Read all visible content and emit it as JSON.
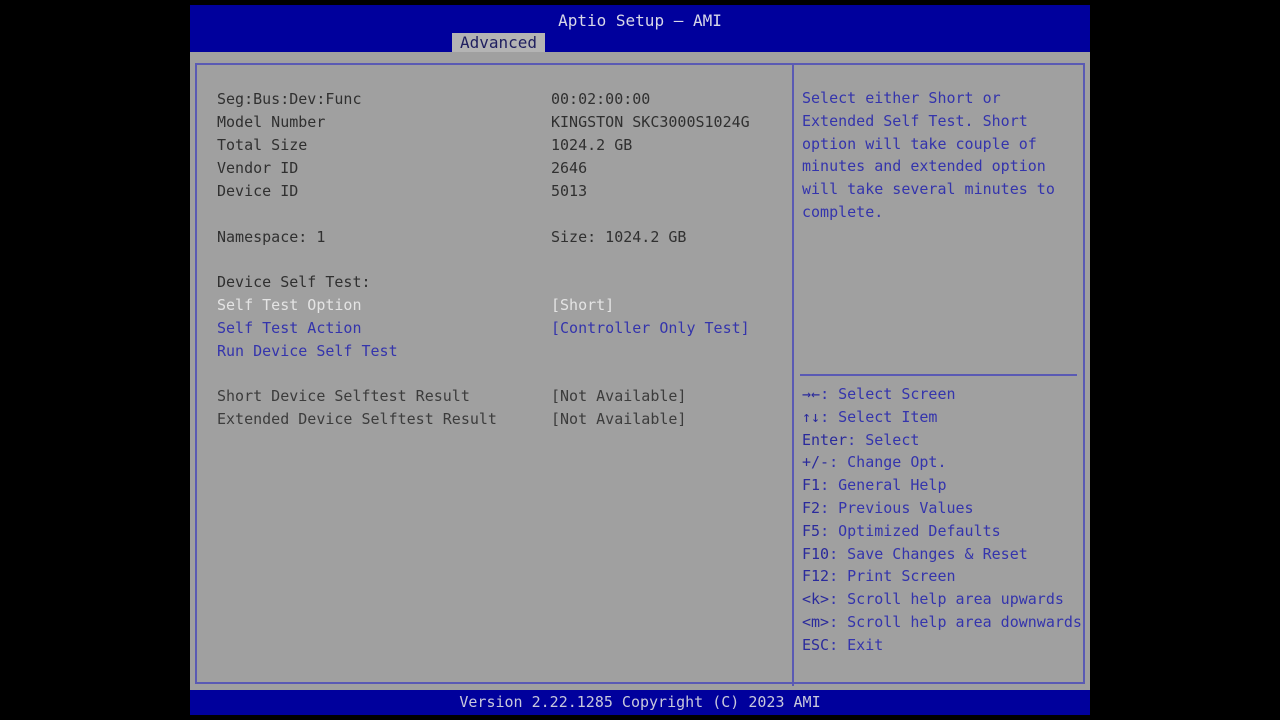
{
  "header": {
    "title": "Aptio Setup – AMI",
    "tabs": [
      {
        "label": "Advanced",
        "active": true
      }
    ]
  },
  "left_pane": {
    "info_rows": [
      {
        "label": "Seg:Bus:Dev:Func",
        "value": "00:02:00:00"
      },
      {
        "label": "Model Number",
        "value": "KINGSTON SKC3000S1024G"
      },
      {
        "label": "Total Size",
        "value": "1024.2 GB"
      },
      {
        "label": "Vendor ID",
        "value": "2646"
      },
      {
        "label": "Device ID",
        "value": "5013"
      }
    ],
    "namespace_row": {
      "label": "Namespace: 1",
      "value": "Size: 1024.2 GB"
    },
    "section_header": "Device Self Test:",
    "self_test_rows": [
      {
        "label": "Self Test Option",
        "value": "[Short]",
        "state": "selected"
      },
      {
        "label": "Self Test Action",
        "value": "[Controller Only Test]",
        "state": "link"
      },
      {
        "label": "Run Device Self Test",
        "value": "",
        "state": "link"
      }
    ],
    "result_rows": [
      {
        "label": "Short Device Selftest Result",
        "value": "[Not Available]"
      },
      {
        "label": "Extended Device Selftest Result",
        "value": "[Not Available]"
      }
    ]
  },
  "right_pane": {
    "help_text": "Select either Short or Extended Self Test. Short option will take couple of minutes and extended option will take several minutes to complete.",
    "legend": [
      {
        "key": "→←",
        "label": ": Select Screen"
      },
      {
        "key": "↑↓",
        "label": ": Select Item"
      },
      {
        "key": "Enter",
        "label": ": Select"
      },
      {
        "key": "+/-",
        "label": ": Change Opt."
      },
      {
        "key": "F1",
        "label": ": General Help"
      },
      {
        "key": "F2",
        "label": ": Previous Values"
      },
      {
        "key": "F5",
        "label": ": Optimized Defaults"
      },
      {
        "key": "F10",
        "label": ": Save Changes & Reset"
      },
      {
        "key": "F12",
        "label": ": Print Screen"
      },
      {
        "key": "<k>",
        "label": ": Scroll help area upwards"
      },
      {
        "key": "<m>",
        "label": ": Scroll help area downwards"
      },
      {
        "key": "ESC",
        "label": ": Exit"
      }
    ]
  },
  "footer": {
    "version_text": "Version 2.22.1285 Copyright (C) 2023 AMI"
  },
  "colors": {
    "header_blue": "#00009c",
    "body_grey": "#a0a0a0",
    "border_blue": "#5a5ab4",
    "link_blue": "#3434ac",
    "info_dark": "#303030",
    "selected_light": "#e4e4e4"
  }
}
